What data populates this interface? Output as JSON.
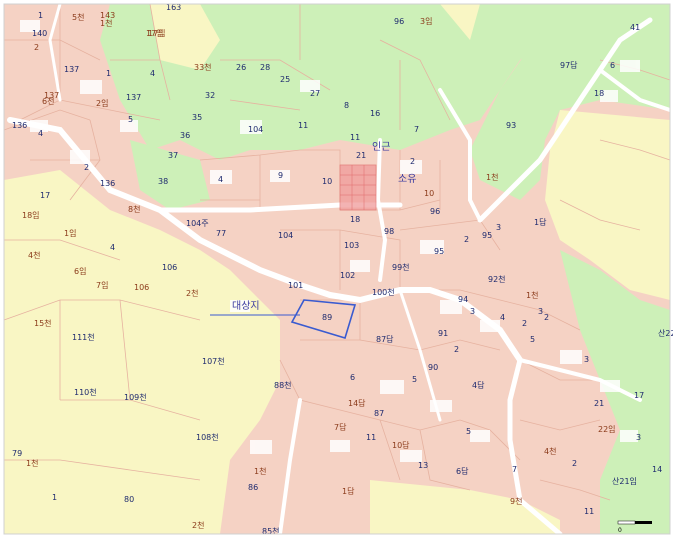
{
  "colors": {
    "residential": "#f5d2c4",
    "forest": "#cdf0b8",
    "farmland": "#f9f6c4",
    "road": "#ffffff",
    "parcel_line": "#e6b2a0",
    "subject_parcel": "#3a5bd0",
    "annex_parcel": "#f09a9a",
    "annotation": "#3a3aa0"
  },
  "annotations": {
    "subject_label": "대상지",
    "annex_label": "인근",
    "mountain_label": "소유"
  },
  "scale_bar": {
    "label": "0"
  },
  "parcels": [
    {
      "t": "1",
      "c": "blue"
    },
    {
      "t": "5천",
      "c": "brown"
    },
    {
      "t": "143",
      "c": "brown"
    },
    {
      "t": "1천",
      "c": "brown"
    },
    {
      "t": "140",
      "c": "blue"
    },
    {
      "t": "2",
      "c": "brown"
    },
    {
      "t": "17임",
      "c": "brown"
    },
    {
      "t": "137",
      "c": "blue"
    },
    {
      "t": "1",
      "c": "blue"
    },
    {
      "t": "4",
      "c": "blue"
    },
    {
      "t": "137",
      "c": "brown"
    },
    {
      "t": "6천",
      "c": "brown"
    },
    {
      "t": "2임",
      "c": "brown"
    },
    {
      "t": "137",
      "c": "blue"
    },
    {
      "t": "5",
      "c": "blue"
    },
    {
      "t": "136",
      "c": "blue"
    },
    {
      "t": "4",
      "c": "blue"
    },
    {
      "t": "2",
      "c": "blue"
    },
    {
      "t": "136",
      "c": "blue"
    },
    {
      "t": "8천",
      "c": "brown"
    },
    {
      "t": "17",
      "c": "blue"
    },
    {
      "t": "18임",
      "c": "brown"
    },
    {
      "t": "1임",
      "c": "brown"
    },
    {
      "t": "4",
      "c": "blue"
    },
    {
      "t": "4천",
      "c": "brown"
    },
    {
      "t": "6임",
      "c": "brown"
    },
    {
      "t": "7임",
      "c": "brown"
    },
    {
      "t": "106",
      "c": "blue"
    },
    {
      "t": "106",
      "c": "brown"
    },
    {
      "t": "2천",
      "c": "brown"
    },
    {
      "t": "15천",
      "c": "brown"
    },
    {
      "t": "111천",
      "c": "blue"
    },
    {
      "t": "107천",
      "c": "blue"
    },
    {
      "t": "110천",
      "c": "blue"
    },
    {
      "t": "109천",
      "c": "blue"
    },
    {
      "t": "108천",
      "c": "blue"
    },
    {
      "t": "79",
      "c": "blue"
    },
    {
      "t": "1천",
      "c": "brown"
    },
    {
      "t": "1",
      "c": "blue"
    },
    {
      "t": "80",
      "c": "blue"
    },
    {
      "t": "2천",
      "c": "brown"
    },
    {
      "t": "163",
      "c": "blue"
    },
    {
      "t": "96",
      "c": "blue"
    },
    {
      "t": "3임",
      "c": "brown"
    },
    {
      "t": "17임",
      "c": "brown"
    },
    {
      "t": "33천",
      "c": "brown"
    },
    {
      "t": "26",
      "c": "blue"
    },
    {
      "t": "28",
      "c": "blue"
    },
    {
      "t": "25",
      "c": "blue"
    },
    {
      "t": "27",
      "c": "blue"
    },
    {
      "t": "32",
      "c": "blue"
    },
    {
      "t": "35",
      "c": "blue"
    },
    {
      "t": "36",
      "c": "blue"
    },
    {
      "t": "37",
      "c": "blue"
    },
    {
      "t": "38",
      "c": "blue"
    },
    {
      "t": "104",
      "c": "blue"
    },
    {
      "t": "11",
      "c": "blue"
    },
    {
      "t": "8",
      "c": "blue"
    },
    {
      "t": "16",
      "c": "blue"
    },
    {
      "t": "7",
      "c": "blue"
    },
    {
      "t": "11",
      "c": "blue"
    },
    {
      "t": "21",
      "c": "blue"
    },
    {
      "t": "9",
      "c": "blue"
    },
    {
      "t": "10",
      "c": "blue"
    },
    {
      "t": "4",
      "c": "blue"
    },
    {
      "t": "2",
      "c": "blue"
    },
    {
      "t": "10",
      "c": "brown"
    },
    {
      "t": "18",
      "c": "blue"
    },
    {
      "t": "96",
      "c": "blue"
    },
    {
      "t": "98",
      "c": "blue"
    },
    {
      "t": "95",
      "c": "blue"
    },
    {
      "t": "95",
      "c": "blue"
    },
    {
      "t": "3",
      "c": "blue"
    },
    {
      "t": "2",
      "c": "blue"
    },
    {
      "t": "104주",
      "c": "blue"
    },
    {
      "t": "77",
      "c": "blue"
    },
    {
      "t": "104",
      "c": "blue"
    },
    {
      "t": "103",
      "c": "blue"
    },
    {
      "t": "99천",
      "c": "blue"
    },
    {
      "t": "102",
      "c": "blue"
    },
    {
      "t": "101",
      "c": "blue"
    },
    {
      "t": "100천",
      "c": "blue"
    },
    {
      "t": "92천",
      "c": "blue"
    },
    {
      "t": "94",
      "c": "blue"
    },
    {
      "t": "89",
      "c": "blue"
    },
    {
      "t": "87답",
      "c": "blue"
    },
    {
      "t": "91",
      "c": "blue"
    },
    {
      "t": "90",
      "c": "blue"
    },
    {
      "t": "88천",
      "c": "blue"
    },
    {
      "t": "6",
      "c": "blue"
    },
    {
      "t": "5",
      "c": "blue"
    },
    {
      "t": "87",
      "c": "blue"
    },
    {
      "t": "14답",
      "c": "brown"
    },
    {
      "t": "7답",
      "c": "brown"
    },
    {
      "t": "11",
      "c": "blue"
    },
    {
      "t": "10답",
      "c": "brown"
    },
    {
      "t": "13",
      "c": "blue"
    },
    {
      "t": "5",
      "c": "blue"
    },
    {
      "t": "6답",
      "c": "blue"
    },
    {
      "t": "4답",
      "c": "blue"
    },
    {
      "t": "86",
      "c": "blue"
    },
    {
      "t": "1답",
      "c": "brown"
    },
    {
      "t": "1천",
      "c": "brown"
    },
    {
      "t": "85천",
      "c": "blue"
    },
    {
      "t": "97답",
      "c": "blue"
    },
    {
      "t": "93",
      "c": "blue"
    },
    {
      "t": "41",
      "c": "blue"
    },
    {
      "t": "6",
      "c": "blue"
    },
    {
      "t": "18",
      "c": "blue"
    },
    {
      "t": "1천",
      "c": "brown"
    },
    {
      "t": "1답",
      "c": "blue"
    },
    {
      "t": "1천",
      "c": "brown"
    },
    {
      "t": "2",
      "c": "blue"
    },
    {
      "t": "2",
      "c": "blue"
    },
    {
      "t": "3",
      "c": "blue"
    },
    {
      "t": "산22",
      "c": "blue"
    },
    {
      "t": "17",
      "c": "blue"
    },
    {
      "t": "3",
      "c": "blue"
    },
    {
      "t": "14",
      "c": "blue"
    },
    {
      "t": "22임",
      "c": "brown"
    },
    {
      "t": "21",
      "c": "blue"
    },
    {
      "t": "2",
      "c": "blue"
    },
    {
      "t": "산21임",
      "c": "blue"
    },
    {
      "t": "11",
      "c": "blue"
    },
    {
      "t": "7",
      "c": "blue"
    },
    {
      "t": "9천",
      "c": "brown"
    },
    {
      "t": "4천",
      "c": "brown"
    },
    {
      "t": "3",
      "c": "blue"
    },
    {
      "t": "5",
      "c": "blue"
    },
    {
      "t": "4",
      "c": "blue"
    },
    {
      "t": "3",
      "c": "blue"
    },
    {
      "t": "2",
      "c": "blue"
    }
  ]
}
